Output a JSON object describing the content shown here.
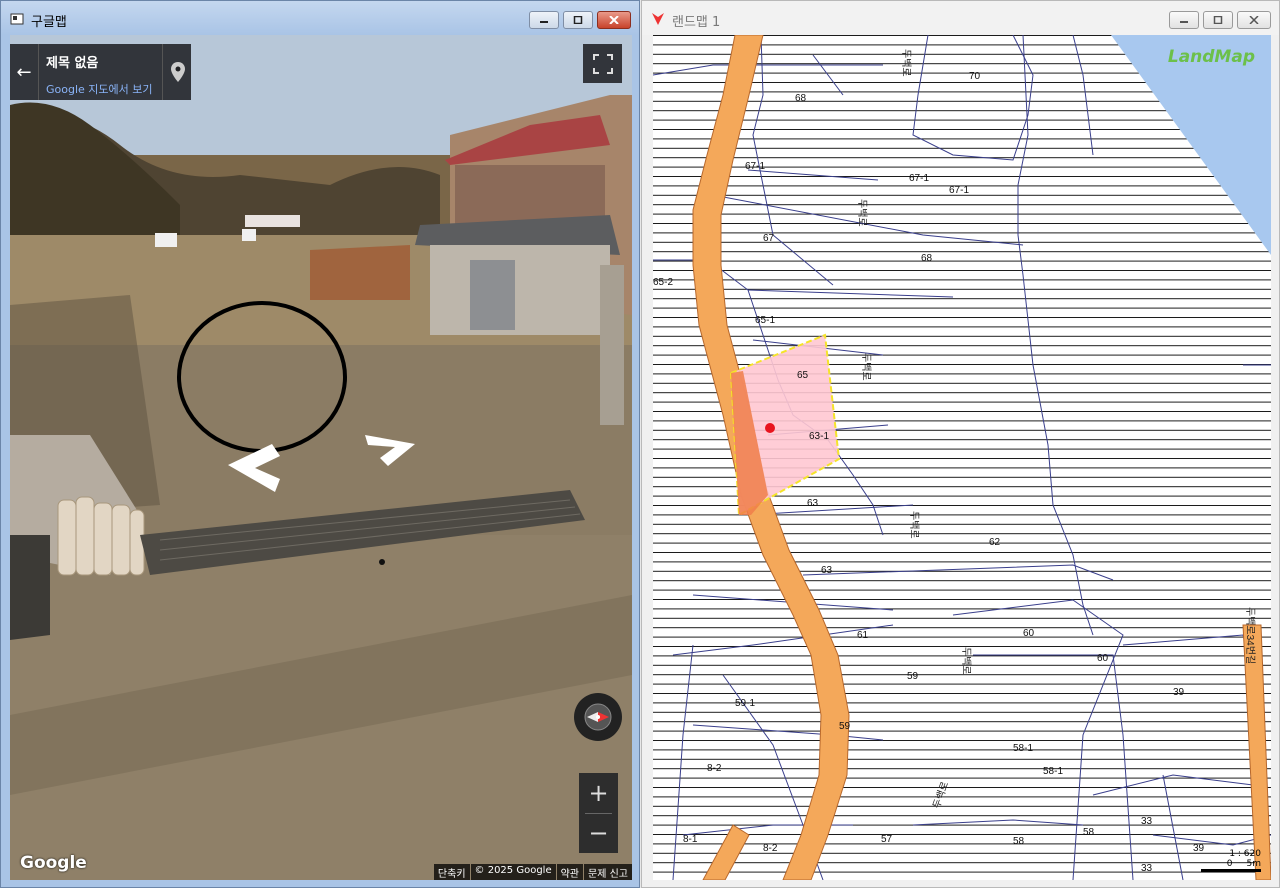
{
  "left_window": {
    "title": "구글맵",
    "card": {
      "title": "제목 없음",
      "subtitle": "Google 지도에서 보기"
    },
    "google_logo": "Google",
    "attribution": [
      "단축키",
      "© 2025 Google",
      "약관",
      "문제 신고"
    ],
    "zoom": {
      "in": "+",
      "out": "−"
    }
  },
  "right_window": {
    "title": "랜드맵 1",
    "logo": "LandMap",
    "scale": {
      "ratio": "1 : 620",
      "label_zero": "0",
      "label_len": "5m"
    },
    "parcels": [
      "70",
      "68",
      "67-1",
      "67-1",
      "67-1",
      "67",
      "68",
      "65-2",
      "65-1",
      "65",
      "63-1",
      "63",
      "62",
      "63",
      "61",
      "60",
      "60",
      "59",
      "39",
      "59-1",
      "59",
      "58-1",
      "58-1",
      "8-2",
      "8-1",
      "8-2",
      "57",
      "58",
      "58",
      "33",
      "33",
      "39"
    ],
    "roads": [
      "두백로",
      "두백로",
      "두백로",
      "두백로",
      "두백로",
      "두백로",
      "두백로34번길"
    ]
  },
  "colors": {
    "road": "#f4a85a",
    "selected_fill": "#ffc8d2",
    "selected_border": "#f5e42a",
    "marker": "#e8141e",
    "water": "#a8c8ef"
  }
}
